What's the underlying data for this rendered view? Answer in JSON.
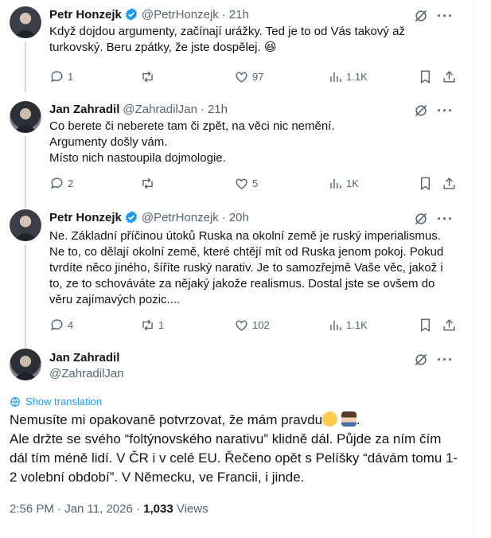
{
  "replies": [
    {
      "author": "Petr Honzejk",
      "handle": "@PetrHonzejk",
      "time": "21h",
      "text": "Když dojdou argumenty, začínají urážky. Ted je to od Vás takový až\nturkovský. Beru zpátky, že jste dospělej. 😆",
      "stats": {
        "replies": "1",
        "reposts": "",
        "likes": "97",
        "views": "1.1K"
      }
    },
    {
      "author": "Jan Zahradil",
      "handle": "@ZahradilJan",
      "time": "21h",
      "text": "Co berete či neberete tam či zpět, na věci nic nemění.\nArgumenty došly vám.\nMísto nich nastoupila dojmologie.",
      "stats": {
        "replies": "2",
        "reposts": "",
        "likes": "5",
        "views": "1K"
      }
    },
    {
      "author": "Petr Honzejk",
      "handle": "@PetrHonzejk",
      "time": "20h",
      "text": "Ne. Základní příčinou útoků Ruska na okolní země je  ruský imperialismus.\nNe to, co dělají okolní země, které chtějí mít od Ruska jenom pokoj. Pokud\ntvrdíte něco jiného, šíříte ruský narativ. Je to samozřejmě Vaše věc, jakož i\nto, ze to schováváte za nějaký jakože realismus. Dostal jste se ovšem do\nvěru zajímavých pozic....",
      "stats": {
        "replies": "4",
        "reposts": "1",
        "likes": "102",
        "views": "1.1K"
      }
    }
  ],
  "main": {
    "author": "Jan Zahradil",
    "handle": "@ZahradilJan",
    "show_translation": "Show translation",
    "line1": "Nemusíte mi opakovaně potvrzovat, že mám pravdu",
    "line1_end": ".",
    "body": "Ale držte se svého “foltýnovského narativu” klidně dál. Půjde za ním čím\ndál tím méně lidí. V ČR i v celé EU. Řečeno opět s Pelíšky “dávám tomu 1-\n2 volební období”. V Německu, ve Francii, i jinde.",
    "timestamp": "2:56 PM · Jan 11, 2026 · ",
    "views_count": "1,033",
    "views_label": " Views"
  },
  "ui": {
    "more_glyph": "···",
    "accent": "#1d9bf0",
    "icons": [
      "verified-badge-icon",
      "grok-icon",
      "more-icon",
      "reply-icon",
      "repost-icon",
      "like-icon",
      "views-icon",
      "bookmark-icon",
      "share-icon",
      "translate-icon"
    ]
  }
}
